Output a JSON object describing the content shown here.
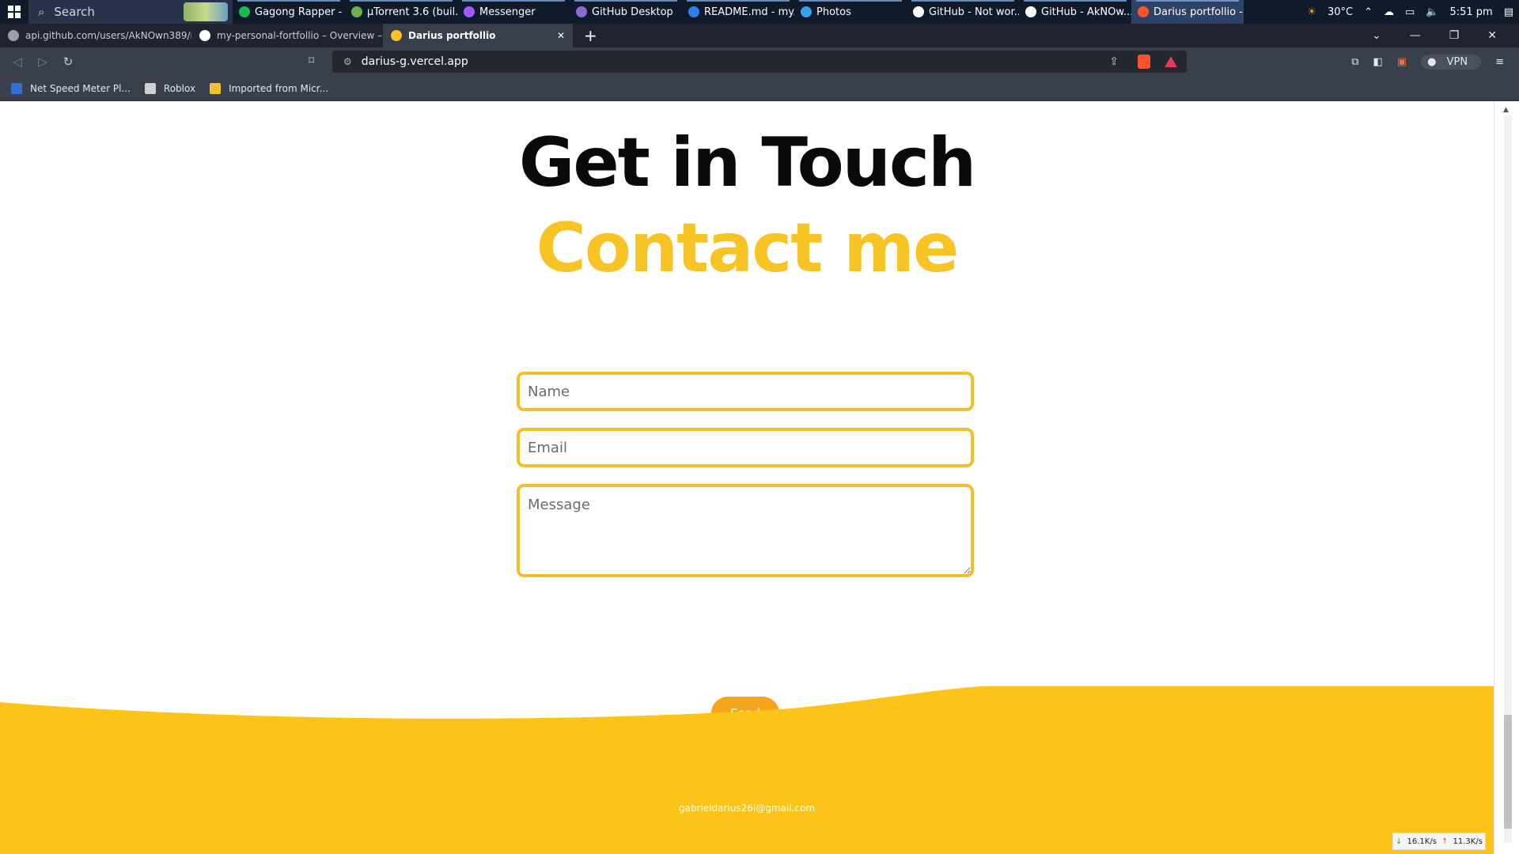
{
  "taskbar": {
    "search_label": "Search",
    "apps": [
      {
        "label": "Gagong Rapper - ...",
        "icon": "spotify-icon",
        "color": "#1db954"
      },
      {
        "label": "µTorrent 3.6  (buil...",
        "icon": "utorrent-icon",
        "color": "#6ab04c"
      },
      {
        "label": "Messenger",
        "icon": "messenger-icon",
        "color": "#a259ff"
      },
      {
        "label": "GitHub Desktop",
        "icon": "github-desktop-icon",
        "color": "#8e6bd3"
      },
      {
        "label": "README.md - my...",
        "icon": "vscode-icon",
        "color": "#2f80ed"
      },
      {
        "label": "Photos",
        "icon": "photos-icon",
        "color": "#3aa0e8"
      },
      {
        "label": "GitHub - Not wor...",
        "icon": "github-icon",
        "color": "#ffffff"
      },
      {
        "label": "GitHub - AkNOw...",
        "icon": "github-icon",
        "color": "#ffffff"
      },
      {
        "label": "Darius portfollio - ...",
        "icon": "brave-icon",
        "color": "#fb542b"
      }
    ],
    "weather": "30°C",
    "time": "5:51 pm"
  },
  "tabs": [
    {
      "label": "api.github.com/users/AkNOwn389/rep",
      "icon": "globe-icon",
      "color": "#9aa0aa"
    },
    {
      "label": "my-personal-fortfollio – Overview – Ve",
      "icon": "vercel-icon",
      "color": "#ffffff"
    },
    {
      "label": "Darius portfollio",
      "icon": "user-icon",
      "color": "#f7c325",
      "active": true
    }
  ],
  "toolbar": {
    "url": "darius-g.vercel.app",
    "vpn_label": "VPN"
  },
  "bookmarks": [
    {
      "label": "Net Speed Meter Pl...",
      "icon": "netspeed-icon",
      "color": "#2f6fd6"
    },
    {
      "label": "Roblox",
      "icon": "roblox-icon",
      "color": "#d0d0d0"
    },
    {
      "label": "Imported from Micr...",
      "icon": "folder-icon",
      "color": "#f2c12e"
    }
  ],
  "page": {
    "heading": "Get in Touch",
    "subheading": "Contact me",
    "form": {
      "name_placeholder": "Name",
      "email_placeholder": "Email",
      "message_placeholder": "Message",
      "send_label": "Send"
    },
    "footer_email": "gabrieldarius26l@gmail.com",
    "accent_color": "#f7c325",
    "footer_color": "#fcc419"
  },
  "netspeed": {
    "down": "16.1K/s",
    "up": "11.3K/s"
  }
}
